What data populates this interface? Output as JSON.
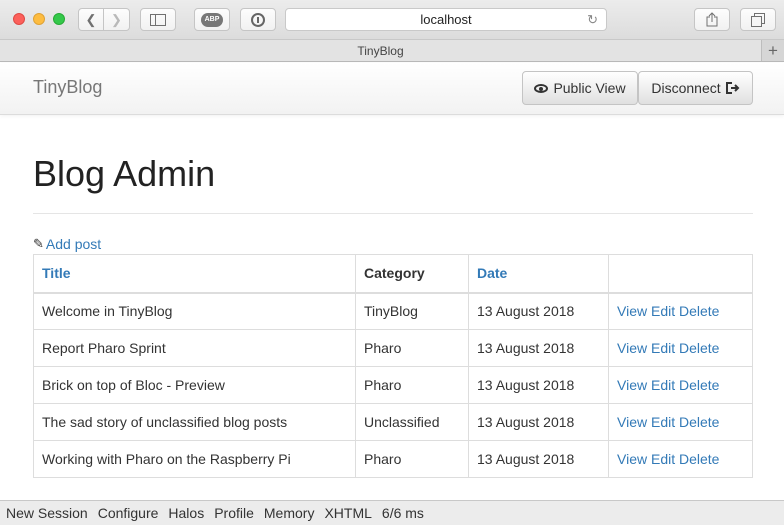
{
  "browser": {
    "url": "localhost",
    "tab_title": "TinyBlog",
    "icons": {
      "back": "chevron-left-icon",
      "forward": "chevron-right-icon",
      "sidebar": "sidebar-icon",
      "abp": "adblock-icon",
      "privacy": "privacy-icon",
      "reload": "reload-icon",
      "share": "share-icon",
      "tabs": "tabs-icon",
      "new_tab": "plus-icon"
    },
    "abp_label": "ABP"
  },
  "navbar": {
    "brand": "TinyBlog",
    "public_view": "Public View",
    "disconnect": "Disconnect"
  },
  "page": {
    "title": "Blog Admin",
    "add_post": "Add post"
  },
  "table": {
    "headers": {
      "title": "Title",
      "category": "Category",
      "date": "Date",
      "actions": ""
    },
    "rows": [
      {
        "title": "Welcome in TinyBlog",
        "category": "TinyBlog",
        "date": "13 August 2018"
      },
      {
        "title": "Report Pharo Sprint",
        "category": "Pharo",
        "date": "13 August 2018"
      },
      {
        "title": "Brick on top of Bloc - Preview",
        "category": "Pharo",
        "date": "13 August 2018"
      },
      {
        "title": "The sad story of unclassified blog posts",
        "category": "Unclassified",
        "date": "13 August 2018"
      },
      {
        "title": "Working with Pharo on the Raspberry Pi",
        "category": "Pharo",
        "date": "13 August 2018"
      }
    ],
    "actions": {
      "view": "View",
      "edit": "Edit",
      "delete": "Delete"
    }
  },
  "footer": {
    "items": [
      "New Session",
      "Configure",
      "Halos",
      "Profile",
      "Memory",
      "XHTML",
      "6/6 ms"
    ]
  },
  "colors": {
    "link": "#337ab7",
    "text": "#333333"
  }
}
